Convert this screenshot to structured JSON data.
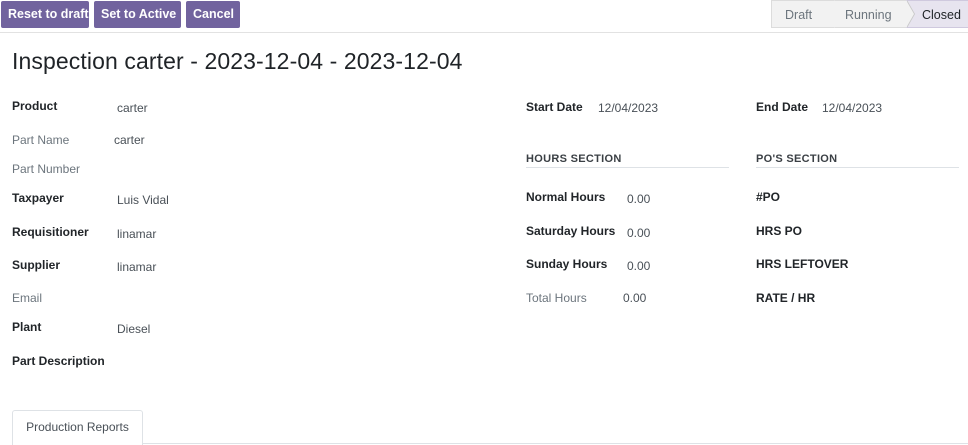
{
  "toolbar": {
    "reset_label": "Reset to draft",
    "active_label": "Set to Active",
    "cancel_label": "Cancel"
  },
  "status": {
    "stages": [
      "Draft",
      "Running",
      "Closed"
    ],
    "current": "Closed"
  },
  "record": {
    "title": "Inspection carter - 2023-12-04 - 2023-12-04"
  },
  "left_fields": {
    "product": {
      "label": "Product",
      "value": "carter"
    },
    "part_name": {
      "label": "Part Name",
      "value": "carter"
    },
    "part_number": {
      "label": "Part Number",
      "value": ""
    },
    "taxpayer": {
      "label": "Taxpayer",
      "value": "Luis Vidal"
    },
    "requisitioner": {
      "label": "Requisitioner",
      "value": "linamar"
    },
    "supplier": {
      "label": "Supplier",
      "value": "linamar"
    },
    "email": {
      "label": "Email",
      "value": ""
    },
    "plant": {
      "label": "Plant",
      "value": "Diesel"
    },
    "part_description": {
      "label": "Part Description",
      "value": ""
    }
  },
  "dates": {
    "start": {
      "label": "Start Date",
      "value": "12/04/2023"
    },
    "end": {
      "label": "End Date",
      "value": "12/04/2023"
    }
  },
  "hours_section": {
    "title": "HOURS SECTION",
    "normal": {
      "label": "Normal Hours",
      "value": "0.00"
    },
    "saturday": {
      "label": "Saturday Hours",
      "value": "0.00"
    },
    "sunday": {
      "label": "Sunday Hours",
      "value": "0.00"
    },
    "total": {
      "label": "Total Hours",
      "value": "0.00"
    }
  },
  "po_section": {
    "title": "PO'S SECTION",
    "po": {
      "label": "#PO"
    },
    "hrs_po": {
      "label": "HRS PO"
    },
    "hrs_leftover": {
      "label": "HRS LEFTOVER"
    },
    "rate": {
      "label": "RATE / HR"
    }
  },
  "tabs": [
    {
      "label": "Production Reports"
    }
  ],
  "colors": {
    "primary": "#71639e",
    "stage_current_bg": "#e7e4ef",
    "stage_bg": "#f2f2f2"
  }
}
